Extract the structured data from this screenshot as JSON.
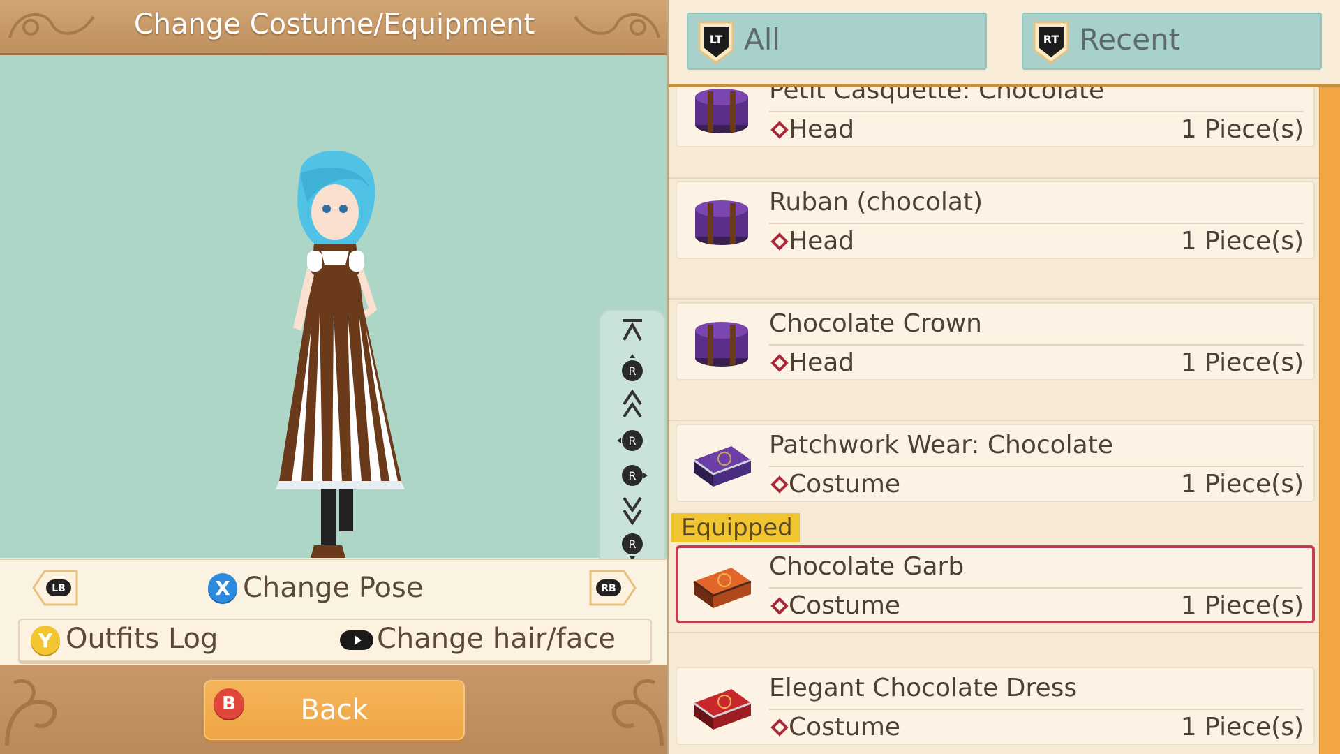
{
  "header": {
    "title": "Change Costume/Equipment"
  },
  "preview": {
    "controls": {
      "lb_label": "LB",
      "rb_label": "RB",
      "x_label": "X",
      "change_pose": "Change Pose",
      "y_label": "Y",
      "outfits_log": "Outfits Log",
      "change_hair_face": "Change hair/face"
    },
    "camera_buttons": [
      "zoom-top-icon",
      "rstick-up-icon",
      "zoom-in-icon",
      "rstick-left-icon",
      "rstick-right-icon",
      "zoom-out-icon",
      "rstick-down-icon",
      "zoom-bottom-icon"
    ],
    "camera_r_label": "R"
  },
  "footer": {
    "b_label": "B",
    "back": "Back"
  },
  "tabs": [
    {
      "shield": "LT",
      "label": "All"
    },
    {
      "shield": "RT",
      "label": "Recent"
    }
  ],
  "items": [
    {
      "name": "Petit Casquette: Chocolate",
      "category": "Head",
      "qty": "1 Piece(s)",
      "icon": "purple-hatbox-icon",
      "equipped": false
    },
    {
      "name": "Ruban (chocolat)",
      "category": "Head",
      "qty": "1 Piece(s)",
      "icon": "purple-hatbox-icon",
      "equipped": false
    },
    {
      "name": "Chocolate Crown",
      "category": "Head",
      "qty": "1 Piece(s)",
      "icon": "purple-hatbox-icon",
      "equipped": false
    },
    {
      "name": "Patchwork Wear: Chocolate",
      "category": "Costume",
      "qty": "1 Piece(s)",
      "icon": "purple-suitcase-icon",
      "equipped": false
    },
    {
      "name": "Chocolate Garb",
      "category": "Costume",
      "qty": "1 Piece(s)",
      "icon": "orange-suitcase-icon",
      "equipped": true
    },
    {
      "name": "Elegant Chocolate Dress",
      "category": "Costume",
      "qty": "1 Piece(s)",
      "icon": "red-suitcase-icon",
      "equipped": false
    }
  ],
  "equipped_label": "Equipped",
  "colors": {
    "accent_orange": "#f2a545",
    "equipped_border": "#c23d52",
    "tab_bg": "#a8d1cc",
    "viewport_bg": "#aed6c6"
  }
}
